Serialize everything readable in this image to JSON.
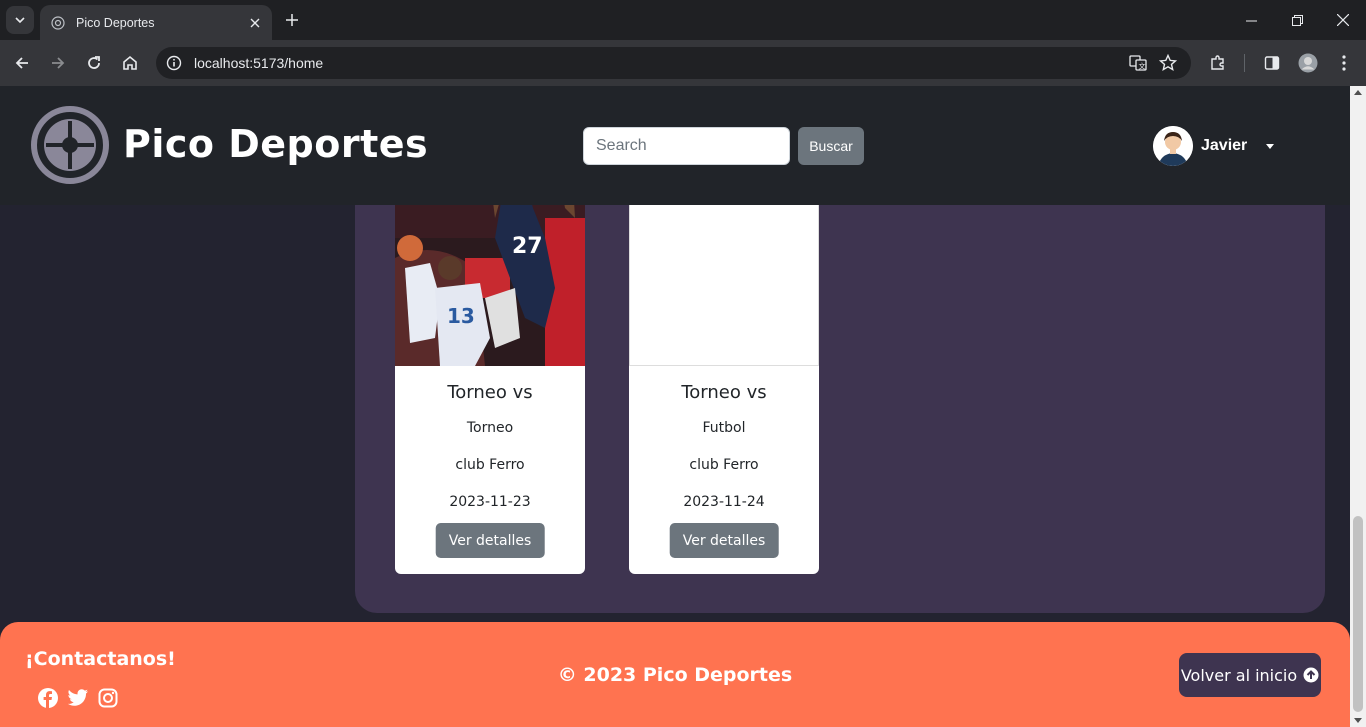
{
  "browser": {
    "tab_title": "Pico Deportes",
    "url": "localhost:5173/home"
  },
  "navbar": {
    "brand": "Pico Deportes",
    "search_placeholder": "Search",
    "search_button": "Buscar",
    "user_name": "Javier"
  },
  "cards": [
    {
      "title": "Torneo vs",
      "type": "Torneo",
      "club": "club Ferro",
      "date": "2023-11-23",
      "button": "Ver detalles"
    },
    {
      "title": "Torneo vs",
      "type": "Futbol",
      "club": "club Ferro",
      "date": "2023-11-24",
      "button": "Ver detalles"
    }
  ],
  "footer": {
    "contact_title": "¡Contactanos!",
    "copyright": "© 2023 Pico Deportes",
    "back_to_top": "Volver al inicio"
  },
  "colors": {
    "navbar_bg": "#212429",
    "page_bg": "#232330",
    "panel_bg": "#3e3450",
    "footer_bg": "#ff7350",
    "button_gray": "#6c757d"
  }
}
